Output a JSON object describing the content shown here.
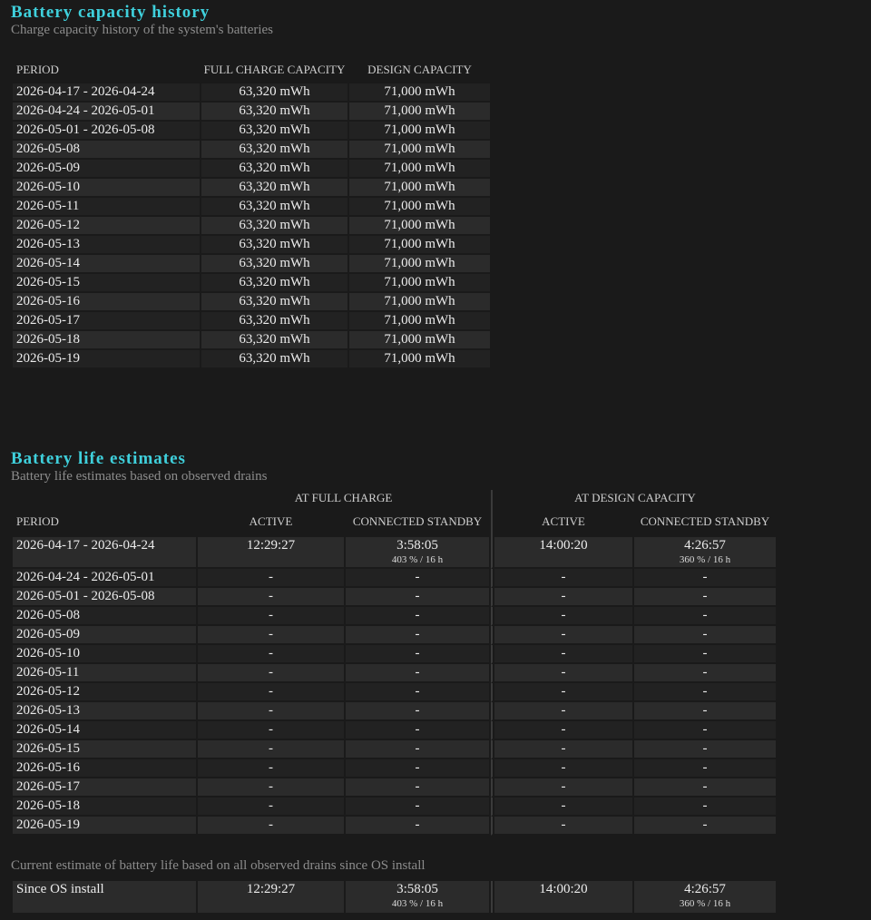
{
  "capacity": {
    "title": "Battery capacity history",
    "subtitle": "Charge capacity history of the system's batteries",
    "headers": {
      "period": "PERIOD",
      "full": "FULL CHARGE CAPACITY",
      "design": "DESIGN CAPACITY"
    },
    "rows": [
      {
        "period": "2026-04-17 - 2026-04-24",
        "full": "63,320 mWh",
        "design": "71,000 mWh"
      },
      {
        "period": "2026-04-24 - 2026-05-01",
        "full": "63,320 mWh",
        "design": "71,000 mWh"
      },
      {
        "period": "2026-05-01 - 2026-05-08",
        "full": "63,320 mWh",
        "design": "71,000 mWh"
      },
      {
        "period": "2026-05-08",
        "full": "63,320 mWh",
        "design": "71,000 mWh"
      },
      {
        "period": "2026-05-09",
        "full": "63,320 mWh",
        "design": "71,000 mWh"
      },
      {
        "period": "2026-05-10",
        "full": "63,320 mWh",
        "design": "71,000 mWh"
      },
      {
        "period": "2026-05-11",
        "full": "63,320 mWh",
        "design": "71,000 mWh"
      },
      {
        "period": "2026-05-12",
        "full": "63,320 mWh",
        "design": "71,000 mWh"
      },
      {
        "period": "2026-05-13",
        "full": "63,320 mWh",
        "design": "71,000 mWh"
      },
      {
        "period": "2026-05-14",
        "full": "63,320 mWh",
        "design": "71,000 mWh"
      },
      {
        "period": "2026-05-15",
        "full": "63,320 mWh",
        "design": "71,000 mWh"
      },
      {
        "period": "2026-05-16",
        "full": "63,320 mWh",
        "design": "71,000 mWh"
      },
      {
        "period": "2026-05-17",
        "full": "63,320 mWh",
        "design": "71,000 mWh"
      },
      {
        "period": "2026-05-18",
        "full": "63,320 mWh",
        "design": "71,000 mWh"
      },
      {
        "period": "2026-05-19",
        "full": "63,320 mWh",
        "design": "71,000 mWh"
      }
    ]
  },
  "life": {
    "title": "Battery life estimates",
    "subtitle": "Battery life estimates based on observed drains",
    "group_full": "AT FULL CHARGE",
    "group_design": "AT DESIGN CAPACITY",
    "headers": {
      "period": "PERIOD",
      "active": "ACTIVE",
      "standby": "CONNECTED STANDBY"
    },
    "first": {
      "period": "2026-04-17 - 2026-04-24",
      "full_active": "12:29:27",
      "full_standby": "3:58:05",
      "full_standby_pct": "403 % / 16 h",
      "design_active": "14:00:20",
      "design_standby": "4:26:57",
      "design_standby_pct": "360 % / 16 h"
    },
    "rows": [
      {
        "period": "2026-04-24 - 2026-05-01",
        "v": "-"
      },
      {
        "period": "2026-05-01 - 2026-05-08",
        "v": "-"
      },
      {
        "period": "2026-05-08",
        "v": "-"
      },
      {
        "period": "2026-05-09",
        "v": "-"
      },
      {
        "period": "2026-05-10",
        "v": "-"
      },
      {
        "period": "2026-05-11",
        "v": "-"
      },
      {
        "period": "2026-05-12",
        "v": "-"
      },
      {
        "period": "2026-05-13",
        "v": "-"
      },
      {
        "period": "2026-05-14",
        "v": "-"
      },
      {
        "period": "2026-05-15",
        "v": "-"
      },
      {
        "period": "2026-05-16",
        "v": "-"
      },
      {
        "period": "2026-05-17",
        "v": "-"
      },
      {
        "period": "2026-05-18",
        "v": "-"
      },
      {
        "period": "2026-05-19",
        "v": "-"
      }
    ],
    "current_note": "Current estimate of battery life based on all observed drains since OS install",
    "since": {
      "period": "Since OS install",
      "full_active": "12:29:27",
      "full_standby": "3:58:05",
      "full_standby_pct": "403 % / 16 h",
      "design_active": "14:00:20",
      "design_standby": "4:26:57",
      "design_standby_pct": "360 % / 16 h"
    }
  }
}
